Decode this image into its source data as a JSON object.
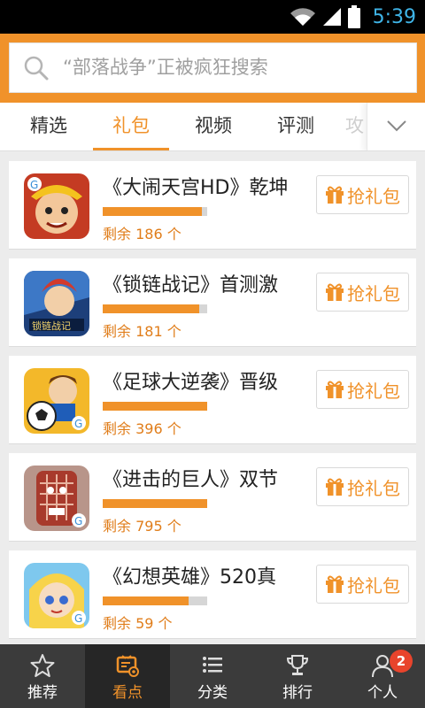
{
  "status_bar": {
    "time": "5:39",
    "icons": [
      "wifi-icon",
      "signal-icon",
      "battery-icon"
    ]
  },
  "search": {
    "placeholder": "“部落战争”正被疯狂搜索",
    "icon": "search-icon"
  },
  "tabs": [
    {
      "label": "精选",
      "active": false
    },
    {
      "label": "礼包",
      "active": true
    },
    {
      "label": "视频",
      "active": false
    },
    {
      "label": "评测",
      "active": false
    },
    {
      "label": "攻",
      "active": false
    }
  ],
  "tabs_more_icon": "chevron-down-icon",
  "gifts": [
    {
      "title": "《大闹天宫HD》乾坤",
      "remaining": "剩余 186 个",
      "progress": 0.95,
      "button": "抢礼包"
    },
    {
      "title": "《锁链战记》首测激",
      "remaining": "剩余 181 个",
      "progress": 0.92,
      "button": "抢礼包"
    },
    {
      "title": "《足球大逆袭》晋级",
      "remaining": "剩余 396 个",
      "progress": 1.0,
      "button": "抢礼包"
    },
    {
      "title": "《进击的巨人》双节",
      "remaining": "剩余 795 个",
      "progress": 1.0,
      "button": "抢礼包"
    },
    {
      "title": "《幻想英雄》520真",
      "remaining": "剩余 59 个",
      "progress": 0.82,
      "button": "抢礼包"
    }
  ],
  "bottom_nav": [
    {
      "label": "推荐",
      "icon": "star-icon",
      "active": false
    },
    {
      "label": "看点",
      "icon": "eye-tv-icon",
      "active": true
    },
    {
      "label": "分类",
      "icon": "list-icon",
      "active": false
    },
    {
      "label": "排行",
      "icon": "trophy-icon",
      "active": false
    },
    {
      "label": "个人",
      "icon": "person-icon",
      "active": false,
      "badge": "2"
    }
  ],
  "colors": {
    "accent": "#f0922a",
    "nav_bg": "#3b3b3b",
    "nav_active_bg": "#262626",
    "badge": "#e8442c"
  }
}
